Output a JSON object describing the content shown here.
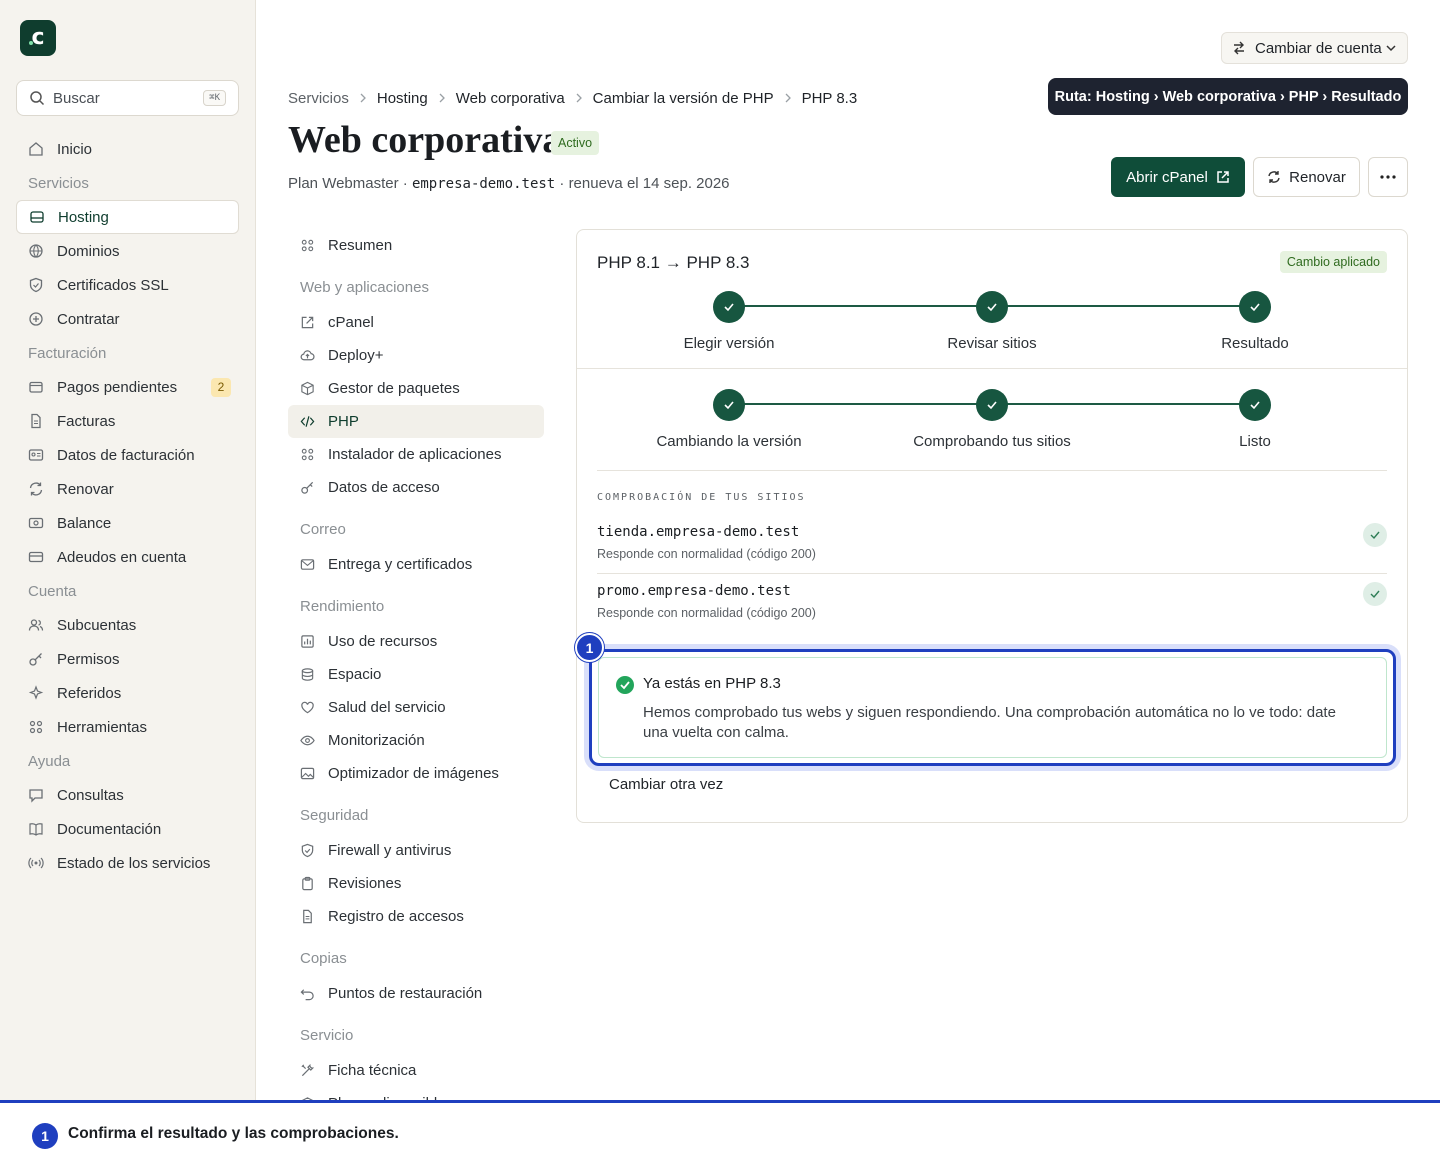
{
  "sidebar": {
    "search_placeholder": "Buscar",
    "search_shortcut": "⌘K",
    "items": [
      {
        "type": "item",
        "label": "Inicio",
        "icon": "home-icon"
      },
      {
        "type": "group",
        "label": "Servicios"
      },
      {
        "type": "item",
        "label": "Hosting",
        "icon": "server-icon",
        "active": true
      },
      {
        "type": "item",
        "label": "Dominios",
        "icon": "globe-icon"
      },
      {
        "type": "item",
        "label": "Certificados SSL",
        "icon": "shield-icon"
      },
      {
        "type": "item",
        "label": "Contratar",
        "icon": "plus-circle-icon"
      },
      {
        "type": "group",
        "label": "Facturación"
      },
      {
        "type": "item",
        "label": "Pagos pendientes",
        "icon": "wallet-icon",
        "badge": "2"
      },
      {
        "type": "item",
        "label": "Facturas",
        "icon": "file-icon"
      },
      {
        "type": "item",
        "label": "Datos de facturación",
        "icon": "id-card-icon"
      },
      {
        "type": "item",
        "label": "Renovar",
        "icon": "refresh-icon"
      },
      {
        "type": "item",
        "label": "Balance",
        "icon": "banknote-icon"
      },
      {
        "type": "item",
        "label": "Adeudos en cuenta",
        "icon": "credit-card-icon"
      },
      {
        "type": "group",
        "label": "Cuenta"
      },
      {
        "type": "item",
        "label": "Subcuentas",
        "icon": "users-icon"
      },
      {
        "type": "item",
        "label": "Permisos",
        "icon": "key-icon"
      },
      {
        "type": "item",
        "label": "Referidos",
        "icon": "sparkles-icon"
      },
      {
        "type": "item",
        "label": "Herramientas",
        "icon": "grid-icon"
      },
      {
        "type": "group",
        "label": "Ayuda"
      },
      {
        "type": "item",
        "label": "Consultas",
        "icon": "chat-icon"
      },
      {
        "type": "item",
        "label": "Documentación",
        "icon": "book-icon"
      },
      {
        "type": "item",
        "label": "Estado de los servicios",
        "icon": "broadcast-icon"
      }
    ]
  },
  "header": {
    "account_switch": "Cambiar de cuenta",
    "tooltip": "Ruta: Hosting › Web corporativa › PHP › Resultado",
    "breadcrumbs": [
      "Servicios",
      "Hosting",
      "Web corporativa",
      "Cambiar la versión de PHP",
      "PHP 8.3"
    ],
    "title": "Web corporativa",
    "status": "Activo",
    "plan_prefix": "Plan Webmaster · ",
    "domain": "empresa-demo.test",
    "plan_suffix": " · renueva el 14 sep. 2026",
    "open_cpanel": "Abrir cPanel",
    "renew": "Renovar"
  },
  "subnav": [
    {
      "type": "item",
      "label": "Resumen",
      "icon": "grid-icon"
    },
    {
      "type": "group",
      "label": "Web y aplicaciones"
    },
    {
      "type": "item",
      "label": "cPanel",
      "icon": "external-link-icon"
    },
    {
      "type": "item",
      "label": "Deploy+",
      "icon": "cloud-upload-icon"
    },
    {
      "type": "item",
      "label": "Gestor de paquetes",
      "icon": "package-icon"
    },
    {
      "type": "item",
      "label": "PHP",
      "icon": "code-icon",
      "active": true
    },
    {
      "type": "item",
      "label": "Instalador de aplicaciones",
      "icon": "grid-icon"
    },
    {
      "type": "item",
      "label": "Datos de acceso",
      "icon": "key-icon"
    },
    {
      "type": "group",
      "label": "Correo"
    },
    {
      "type": "item",
      "label": "Entrega y certificados",
      "icon": "mail-icon"
    },
    {
      "type": "group",
      "label": "Rendimiento"
    },
    {
      "type": "item",
      "label": "Uso de recursos",
      "icon": "chart-icon"
    },
    {
      "type": "item",
      "label": "Espacio",
      "icon": "database-icon"
    },
    {
      "type": "item",
      "label": "Salud del servicio",
      "icon": "heart-icon"
    },
    {
      "type": "item",
      "label": "Monitorización",
      "icon": "eye-icon"
    },
    {
      "type": "item",
      "label": "Optimizador de imágenes",
      "icon": "image-icon"
    },
    {
      "type": "group",
      "label": "Seguridad"
    },
    {
      "type": "item",
      "label": "Firewall y antivirus",
      "icon": "shield-icon"
    },
    {
      "type": "item",
      "label": "Revisiones",
      "icon": "clipboard-icon"
    },
    {
      "type": "item",
      "label": "Registro de accesos",
      "icon": "file-icon"
    },
    {
      "type": "group",
      "label": "Copias"
    },
    {
      "type": "item",
      "label": "Puntos de restauración",
      "icon": "undo-icon"
    },
    {
      "type": "group",
      "label": "Servicio"
    },
    {
      "type": "item",
      "label": "Ficha técnica",
      "icon": "tools-icon"
    },
    {
      "type": "item",
      "label": "Planes disponibles",
      "icon": "layers-icon"
    }
  ],
  "card": {
    "title": "PHP 8.1 → PHP 8.3",
    "badge": "Cambio aplicado",
    "wizard_steps": [
      "Elegir versión",
      "Revisar sitios",
      "Resultado"
    ],
    "progress_steps": [
      "Cambiando la versión",
      "Comprobando tus sitios",
      "Listo"
    ],
    "check_section_label": "COMPROBACIÓN DE TUS SITIOS",
    "sites": [
      {
        "host": "tienda.empresa-demo.test",
        "status": "Responde con normalidad (código 200)"
      },
      {
        "host": "promo.empresa-demo.test",
        "status": "Responde con normalidad (código 200)"
      }
    ],
    "result_title": "Ya estás en PHP 8.3",
    "result_body": "Hemos comprobado tus webs y siguen respondiendo. Una comprobación automática no lo ve todo: date una vuelta con calma.",
    "change_again": "Cambiar otra vez"
  },
  "guide": {
    "step_number": "1",
    "message": "Confirma el resultado y las comprobaciones."
  },
  "colors": {
    "brand": "#0f4d39",
    "accent": "#1f3fbf",
    "success": "#22a55b"
  }
}
